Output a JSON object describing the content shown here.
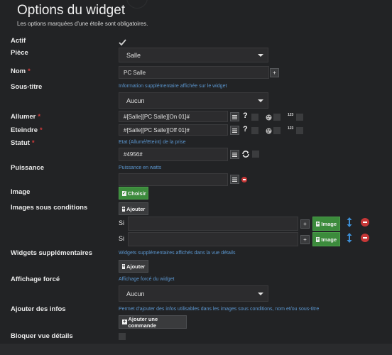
{
  "header": {
    "title": "Options du widget",
    "subtitle": "Les options marquées d'une étoile sont obligatoires."
  },
  "required_marker": "*",
  "fields": {
    "actif": {
      "label": "Actif"
    },
    "piece": {
      "label": "Pièce",
      "value": "Salle"
    },
    "nom": {
      "label": "Nom",
      "value": "PC Salle"
    },
    "sous_titre": {
      "label": "Sous-titre",
      "help": "Information supplémentaire affichée sur le widget",
      "value": "Aucun"
    },
    "allumer": {
      "label": "Allumer",
      "value": "#[Salle][PC Salle][On 01]#",
      "number_label": "123",
      "question": "?"
    },
    "eteindre": {
      "label": "Eteindre",
      "value": "#[Salle][PC Salle][Off 01]#",
      "number_label": "123",
      "question": "?"
    },
    "statut": {
      "label": "Statut",
      "help": "Etat (Allumé/Eteint) de la prise",
      "value": "#4956#"
    },
    "puissance": {
      "label": "Puissance",
      "help": "Puissance en watts",
      "value": ""
    },
    "image": {
      "label": "Image",
      "button": "Choisir"
    },
    "images_sous_conditions": {
      "label": "Images sous conditions",
      "button": "Ajouter",
      "rows": [
        {
          "prefix": "Si",
          "value": "",
          "image_button": "Image"
        },
        {
          "prefix": "Si",
          "value": "",
          "image_button": "Image"
        }
      ]
    },
    "widgets_supplementaires": {
      "label": "Widgets supplémentaires",
      "help": "Widgets supplémentaires affichés dans la vue détails",
      "button": "Ajouter"
    },
    "affichage_force": {
      "label": "Affichage forcé",
      "help": "Affichage forcé du widget",
      "value": "Aucun"
    },
    "ajouter_infos": {
      "label": "Ajouter des infos",
      "help": "Permet d'ajouter des infos utilisables dans les images sous conditions, nom et/ou sous-titre",
      "button": "Ajouter une commande"
    },
    "bloquer_vue": {
      "label": "Bloquer vue détails"
    }
  },
  "colors": {
    "background": "#222325",
    "help_text": "#5b96cf",
    "required": "#d23b3b",
    "green_button": "#3c8b3c",
    "remove": "#c73737",
    "move": "#3d8fd6"
  }
}
